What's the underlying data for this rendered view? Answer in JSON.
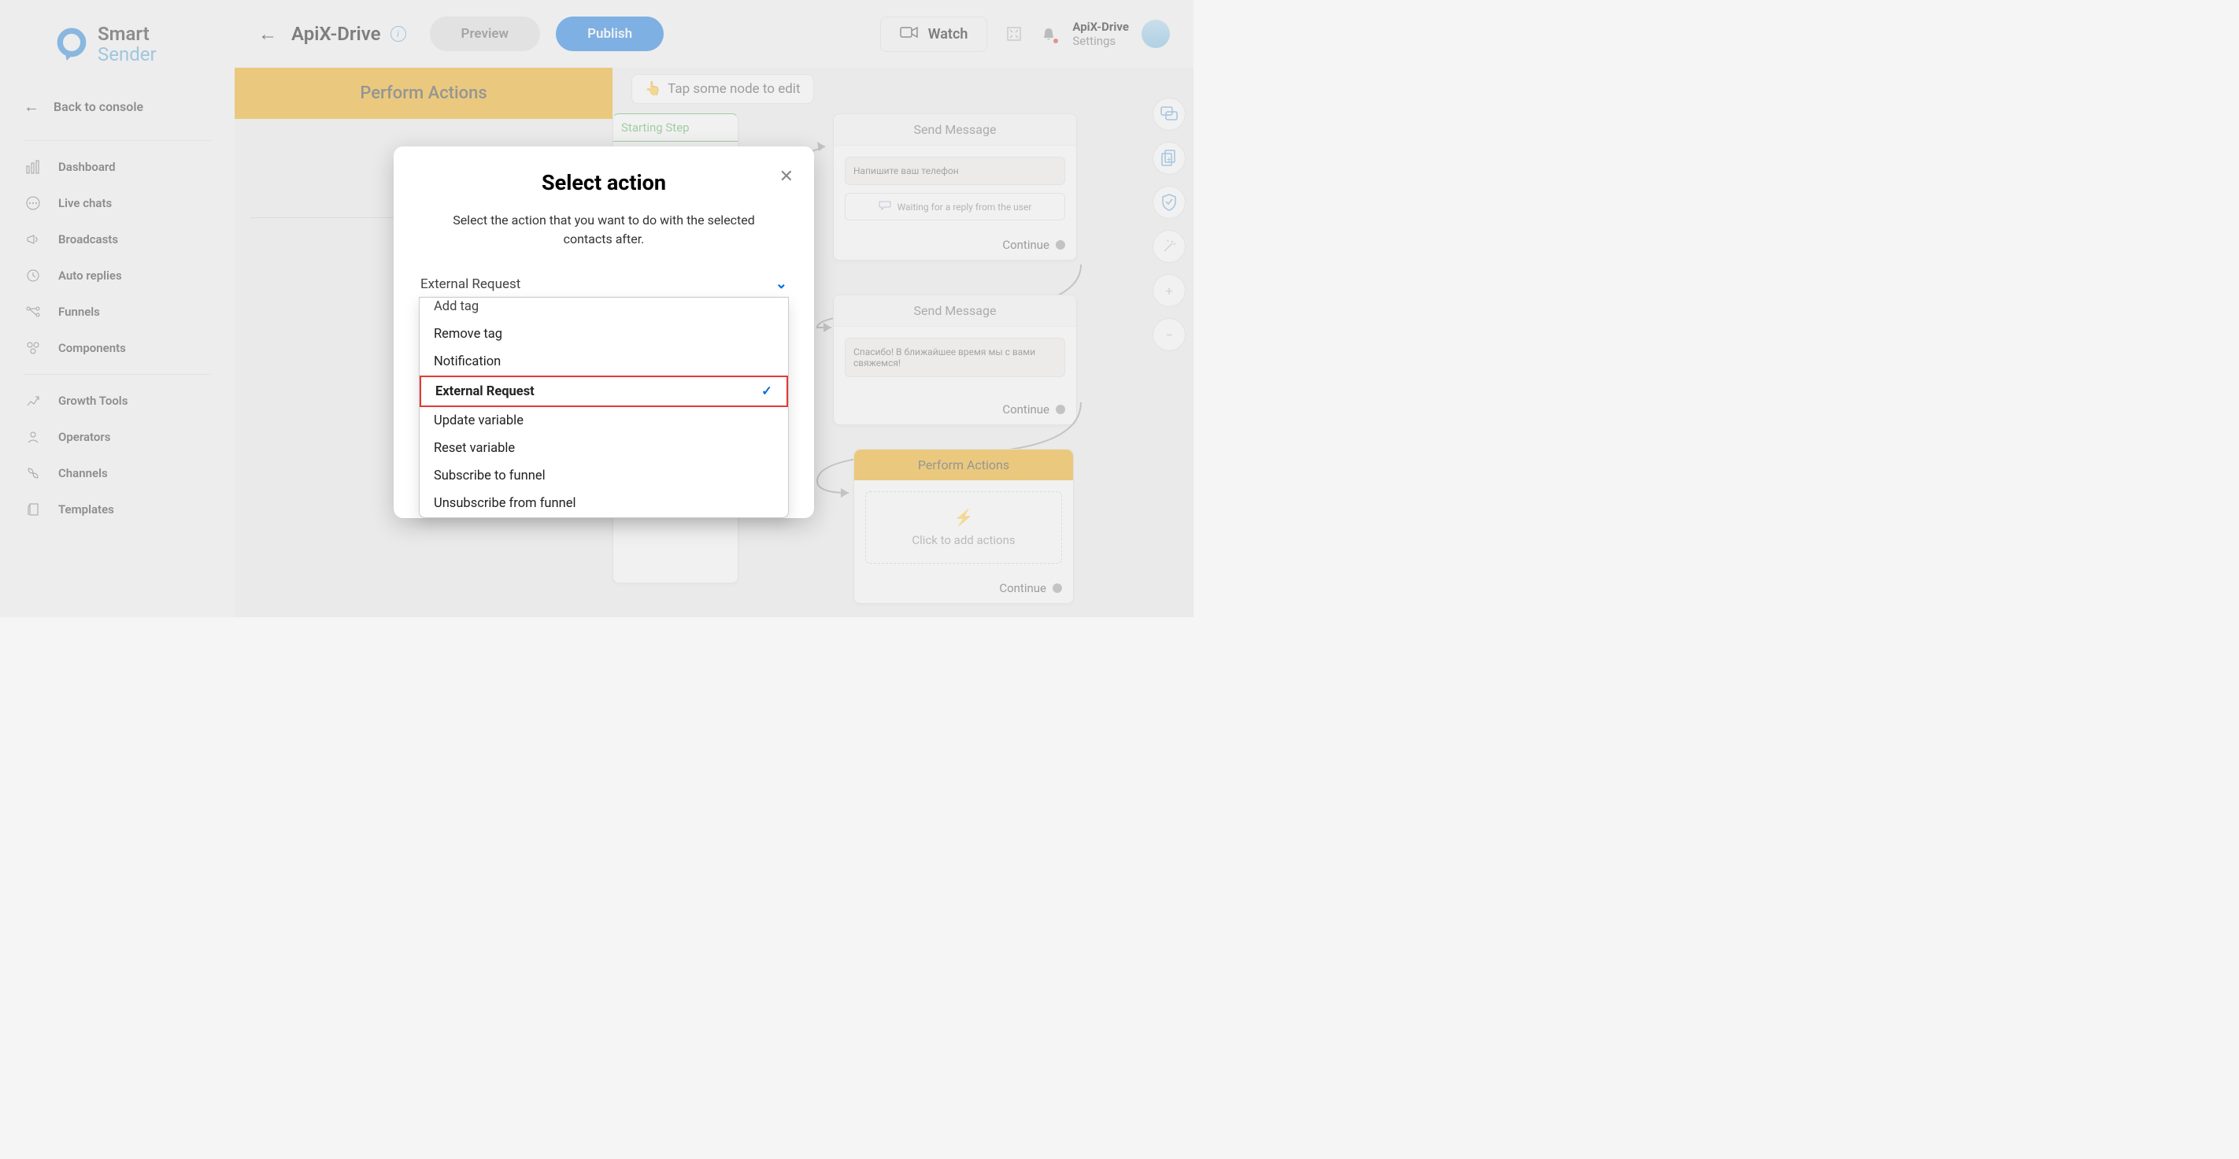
{
  "brand": {
    "line1": "Smart",
    "line2": "Sender"
  },
  "sidebar": {
    "back": "Back to console",
    "items": [
      {
        "label": "Dashboard"
      },
      {
        "label": "Live chats"
      },
      {
        "label": "Broadcasts"
      },
      {
        "label": "Auto replies"
      },
      {
        "label": "Funnels"
      },
      {
        "label": "Components"
      }
    ],
    "items2": [
      {
        "label": "Growth Tools"
      },
      {
        "label": "Operators"
      },
      {
        "label": "Channels"
      },
      {
        "label": "Templates"
      }
    ]
  },
  "topbar": {
    "title": "ApiX-Drive",
    "preview": "Preview",
    "publish": "Publish",
    "watch": "Watch",
    "user": {
      "name": "ApiX-Drive",
      "settings": "Settings"
    }
  },
  "canvas": {
    "perform_header": "Perform Actions",
    "click_text": "Click t",
    "hint": "Tap some node to edit",
    "starting": "Starting Step",
    "send_title": "Send Message",
    "msg1": "Напишите ваш телефон",
    "wait_reply": "Waiting for a reply from the user",
    "msg2": "Спасибо! В ближайшее время мы с вами свяжемся!",
    "continue": "Continue",
    "perform_title": "Perform Actions",
    "add_actions": "Click to add actions"
  },
  "modal": {
    "title": "Select action",
    "subtitle": "Select the action that you want to do with the selected contacts after.",
    "selected": "External Request",
    "options": [
      "Add tag",
      "Remove tag",
      "Notification",
      "External Request",
      "Update variable",
      "Reset variable",
      "Subscribe to funnel",
      "Unsubscribe from funnel"
    ]
  }
}
